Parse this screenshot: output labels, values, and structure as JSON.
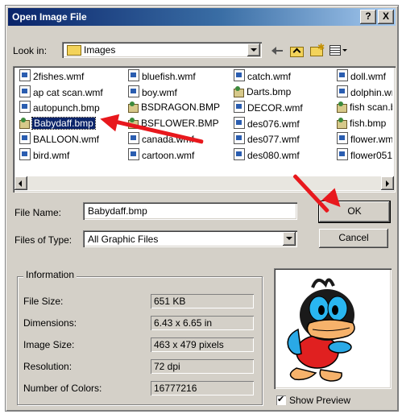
{
  "window": {
    "title": "Open Image File",
    "help_label": "?",
    "close_label": "X"
  },
  "lookin": {
    "label": "Look in:",
    "value": "Images"
  },
  "files": [
    {
      "name": "2fishes.wmf",
      "type": "wmf"
    },
    {
      "name": "ap cat scan.wmf",
      "type": "wmf"
    },
    {
      "name": "autopunch.bmp",
      "type": "wmf"
    },
    {
      "name": "Babydaff.bmp",
      "type": "bmp",
      "selected": true
    },
    {
      "name": "BALLOON.wmf",
      "type": "wmf"
    },
    {
      "name": "bird.wmf",
      "type": "wmf"
    },
    {
      "name": "bluefish.wmf",
      "type": "wmf"
    },
    {
      "name": "boy.wmf",
      "type": "wmf"
    },
    {
      "name": "BSDRAGON.BMP",
      "type": "bmp"
    },
    {
      "name": "BSFLOWER.BMP",
      "type": "bmp"
    },
    {
      "name": "canada.wmf",
      "type": "wmf"
    },
    {
      "name": "cartoon.wmf",
      "type": "wmf"
    },
    {
      "name": "catch.wmf",
      "type": "wmf"
    },
    {
      "name": "Darts.bmp",
      "type": "bmp"
    },
    {
      "name": "DECOR.wmf",
      "type": "wmf"
    },
    {
      "name": "des076.wmf",
      "type": "wmf"
    },
    {
      "name": "des077.wmf",
      "type": "wmf"
    },
    {
      "name": "des080.wmf",
      "type": "wmf"
    },
    {
      "name": "doll.wmf",
      "type": "wmf"
    },
    {
      "name": "dolphin.wn",
      "type": "wmf"
    },
    {
      "name": "fish scan.b",
      "type": "bmp"
    },
    {
      "name": "fish.bmp",
      "type": "bmp"
    },
    {
      "name": "flower.wm",
      "type": "wmf"
    },
    {
      "name": "flower051.",
      "type": "wmf"
    }
  ],
  "filename": {
    "label": "File Name:",
    "value": "Babydaff.bmp"
  },
  "filetype": {
    "label": "Files of Type:",
    "value": "All Graphic Files"
  },
  "buttons": {
    "ok": "OK",
    "cancel": "Cancel"
  },
  "info": {
    "title": "Information",
    "rows": [
      {
        "label": "File Size:",
        "value": "651 KB"
      },
      {
        "label": "Dimensions:",
        "value": "6.43 x 6.65 in"
      },
      {
        "label": "Image Size:",
        "value": "463 x 479 pixels"
      },
      {
        "label": "Resolution:",
        "value": "72 dpi"
      },
      {
        "label": "Number of Colors:",
        "value": "16777216"
      }
    ]
  },
  "preview": {
    "show_label": "Show Preview",
    "checked": true,
    "check_mark": "✔"
  },
  "annotations": {
    "arrow_color": "#e8181d"
  }
}
